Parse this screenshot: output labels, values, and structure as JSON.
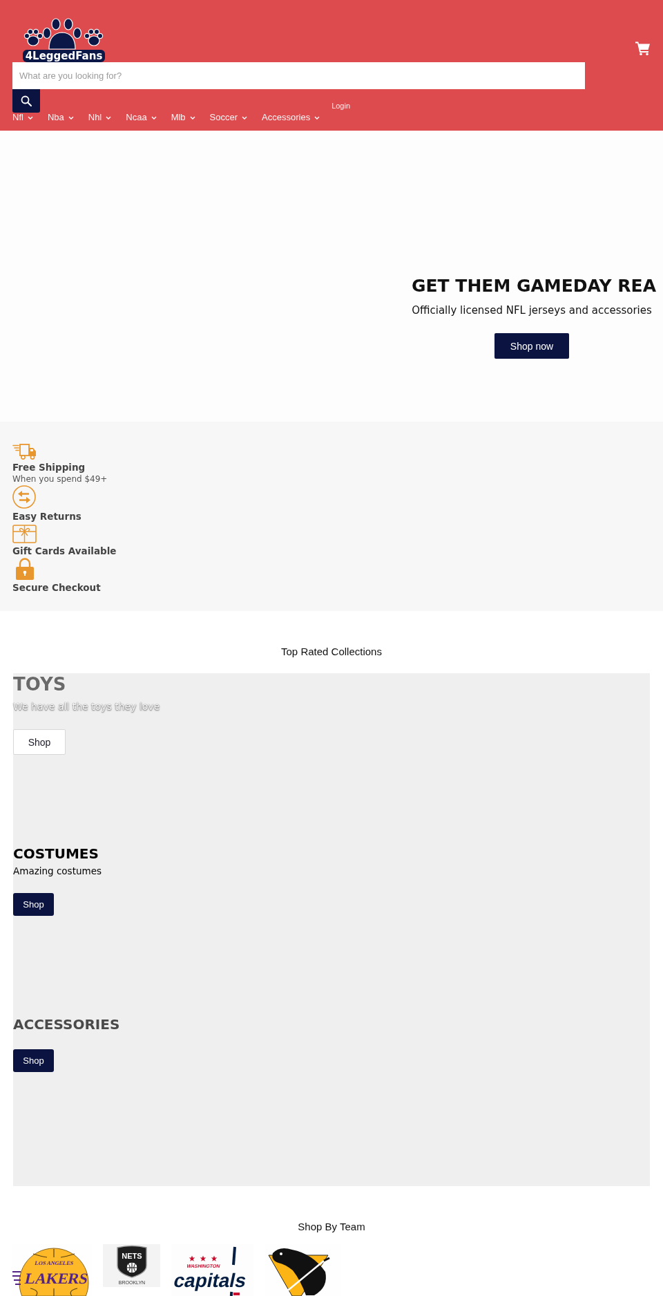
{
  "header": {
    "logo": {
      "text": "4LeggedFans"
    },
    "search": {
      "placeholder": "What are you looking for?"
    },
    "nav": [
      {
        "label": "Nfl",
        "dropdown": true
      },
      {
        "label": "Nba",
        "dropdown": true
      },
      {
        "label": "Nhl",
        "dropdown": true
      },
      {
        "label": "Ncaa",
        "dropdown": true
      },
      {
        "label": "Mlb",
        "dropdown": true
      },
      {
        "label": "Soccer",
        "dropdown": true
      },
      {
        "label": "Accessories",
        "dropdown": true
      }
    ],
    "login": "Login"
  },
  "hero": {
    "title": "GET THEM GAMEDAY REA",
    "subtitle": "Officially licensed NFL jerseys and accessories",
    "button": "Shop now"
  },
  "features": [
    {
      "kind": "truck",
      "title": "Free Shipping",
      "subtitle": "When you spend $49+"
    },
    {
      "kind": "returns",
      "title": "Easy Returns"
    },
    {
      "kind": "gift",
      "title": "Gift Cards Available"
    },
    {
      "kind": "lock",
      "title": "Secure Checkout"
    }
  ],
  "collections": {
    "title": "Top Rated Collections",
    "slides": [
      {
        "kind": "light",
        "title": "TOYS",
        "subtitle": "We have all the toys they love",
        "button": "Shop"
      },
      {
        "kind": "dark",
        "title": "COSTUMES",
        "subtitle": "Amazing costumes",
        "button": "Shop"
      },
      {
        "kind": "muted",
        "title": "ACCESSORIES",
        "button": "Shop"
      }
    ]
  },
  "teams": {
    "title": "Shop By Team",
    "logos": [
      {
        "kind": "basketball",
        "texts": [
          "LOS ANGELES",
          "LAKERS"
        ]
      },
      {
        "kind": "shield",
        "texts": [
          "NETS",
          "BROOKLYN"
        ]
      },
      {
        "kind": "stars",
        "texts": [
          "WASHINGTON",
          "capitals"
        ]
      },
      {
        "kind": "penguin"
      }
    ]
  }
}
